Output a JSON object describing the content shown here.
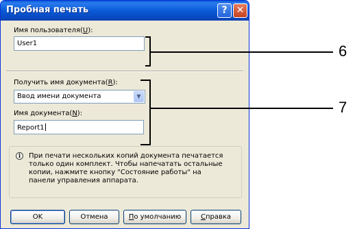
{
  "dialog": {
    "title": "Пробная печать",
    "help_button": "?",
    "close_button": "✕"
  },
  "user_section": {
    "label_text": "Имя пользователя(",
    "label_key": "U",
    "label_tail": "):",
    "value": "User1"
  },
  "document_section": {
    "get_name_label_text": "Получить имя документа(",
    "get_name_label_key": "R",
    "get_name_label_tail": "):",
    "get_name_selected": "Ввод имени документа",
    "name_label_text": "Имя документа(",
    "name_label_key": "N",
    "name_label_tail": "):",
    "name_value": "Report1"
  },
  "info": {
    "icon": "info-icon",
    "lines": [
      "При печати нескольких копий документа печатается",
      "только один комплект. Чтобы напечатать остальные",
      "копии, нажмите кнопку \"Состояние работы\" на",
      "панели управления аппарата."
    ]
  },
  "buttons": {
    "ok": "OK",
    "cancel": "Отмена",
    "defaults_key": "П",
    "defaults_rest": "о умолчанию",
    "help_key": "С",
    "help_rest": "правка"
  },
  "callouts": {
    "user_number": "6",
    "document_number": "7"
  },
  "colors": {
    "titlebar": "#0a5ad7",
    "dialog_bg": "#ece9d8",
    "close_button": "#c4411f",
    "input_border": "#7f9db9"
  }
}
